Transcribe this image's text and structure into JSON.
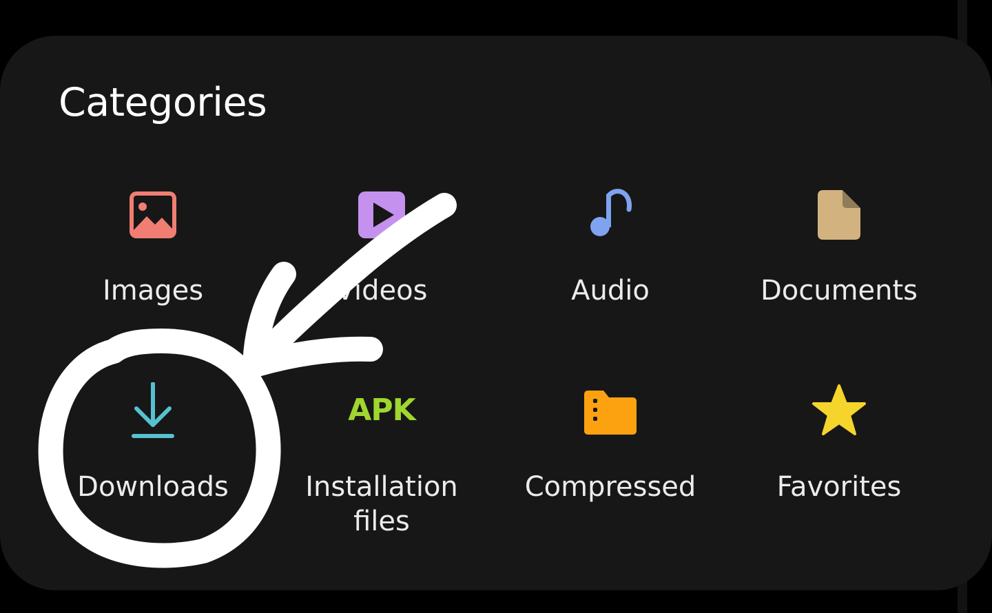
{
  "section_title": "Categories",
  "categories": [
    {
      "label": "Images",
      "icon": "image-icon",
      "color": "#f07e73"
    },
    {
      "label": "Videos",
      "icon": "video-icon",
      "color": "#c591ee"
    },
    {
      "label": "Audio",
      "icon": "music-note-icon",
      "color": "#7fa3ef"
    },
    {
      "label": "Documents",
      "icon": "document-icon",
      "color": "#d2b380"
    },
    {
      "label": "Downloads",
      "icon": "download-icon",
      "color": "#56c2cf"
    },
    {
      "label": "Installation\nfiles",
      "icon": "apk-icon",
      "icon_text": "APK",
      "color": "#9fd62f"
    },
    {
      "label": "Compressed",
      "icon": "zip-folder-icon",
      "color": "#fca10f"
    },
    {
      "label": "Favorites",
      "icon": "star-icon",
      "color": "#f5d52c"
    }
  ],
  "annotation": {
    "shape": "hand-drawn circle and arrow",
    "target": "Downloads",
    "color": "#ffffff"
  }
}
